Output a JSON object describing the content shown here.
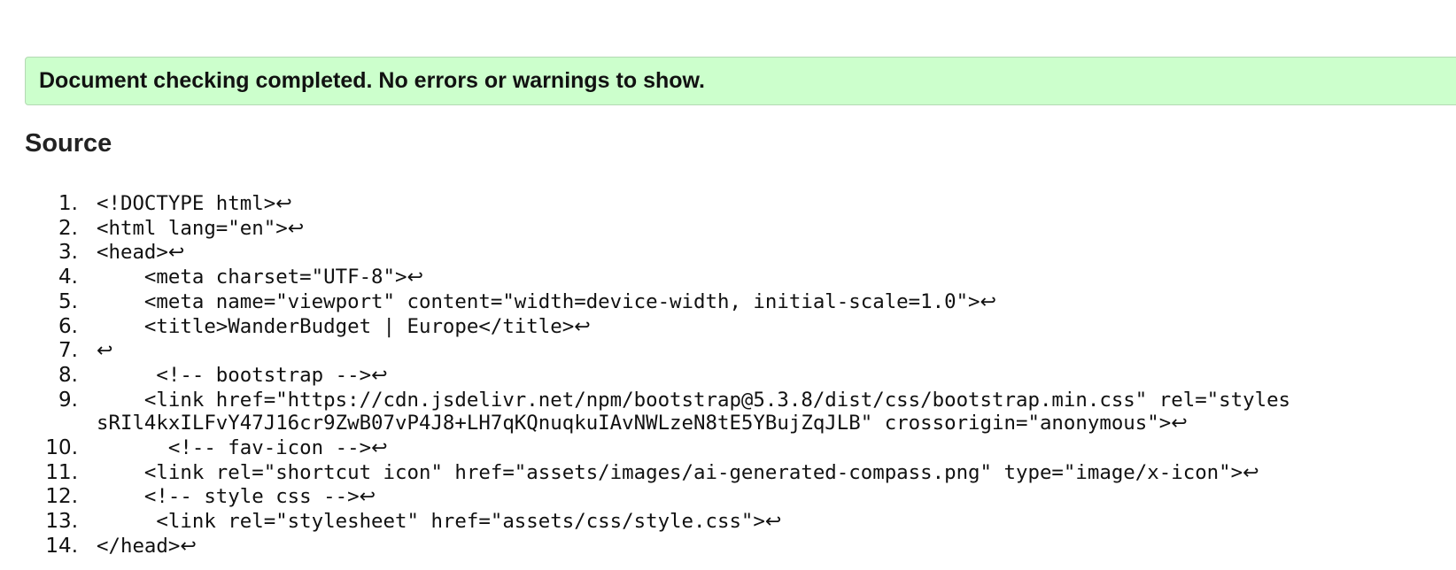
{
  "banner": {
    "message": "Document checking completed. No errors or warnings to show.",
    "color": "#ccffcc"
  },
  "source": {
    "heading": "Source",
    "eol_icon": "↩",
    "lines": [
      {
        "num": "1.",
        "code": "<!DOCTYPE html>"
      },
      {
        "num": "2.",
        "code": "<html lang=\"en\">"
      },
      {
        "num": "3.",
        "code": "<head>"
      },
      {
        "num": "4.",
        "code": "    <meta charset=\"UTF-8\">"
      },
      {
        "num": "5.",
        "code": "    <meta name=\"viewport\" content=\"width=device-width, initial-scale=1.0\">"
      },
      {
        "num": "6.",
        "code": "    <title>WanderBudget | Europe</title>"
      },
      {
        "num": "7.",
        "code": ""
      },
      {
        "num": "8.",
        "code": "     <!-- bootstrap -->"
      },
      {
        "num": "9.",
        "code": "    <link href=\"https://cdn.jsdelivr.net/npm/bootstrap@5.3.8/dist/css/bootstrap.min.css\" rel=\"styles"
      },
      {
        "num": "",
        "code": "sRIl4kxILFvY47J16cr9ZwB07vP4J8+LH7qKQnuqkuIAvNWLzeN8tE5YBujZqJLB\" crossorigin=\"anonymous\">"
      },
      {
        "num": "10.",
        "code": "      <!-- fav-icon -->"
      },
      {
        "num": "11.",
        "code": "    <link rel=\"shortcut icon\" href=\"assets/images/ai-generated-compass.png\" type=\"image/x-icon\">"
      },
      {
        "num": "12.",
        "code": "    <!-- style css -->"
      },
      {
        "num": "13.",
        "code": "     <link rel=\"stylesheet\" href=\"assets/css/style.css\">"
      },
      {
        "num": "14.",
        "code": "</head>"
      }
    ]
  }
}
